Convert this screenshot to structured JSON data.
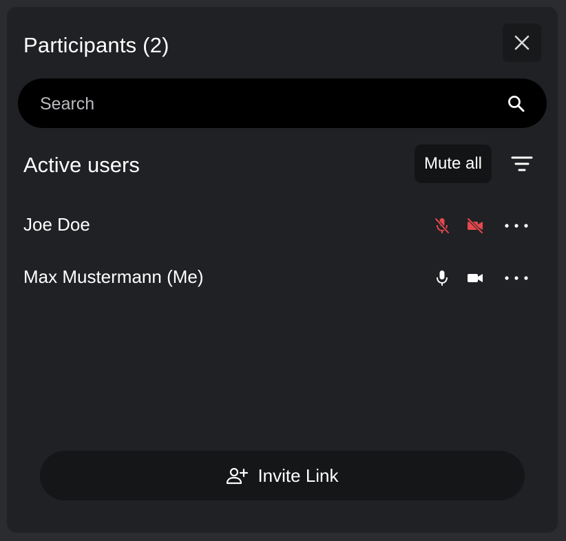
{
  "header": {
    "title": "Participants (2)"
  },
  "search": {
    "placeholder": "Search"
  },
  "section": {
    "title": "Active users",
    "mute_all_label": "Mute all"
  },
  "users": [
    {
      "name": "Joe Doe",
      "mic": "muted",
      "camera": "off"
    },
    {
      "name": "Max Mustermann (Me)",
      "mic": "on",
      "camera": "on"
    }
  ],
  "footer": {
    "invite_label": "Invite Link"
  },
  "colors": {
    "background": "#202124",
    "muted_red": "#e5484d",
    "text": "#ffffff"
  }
}
